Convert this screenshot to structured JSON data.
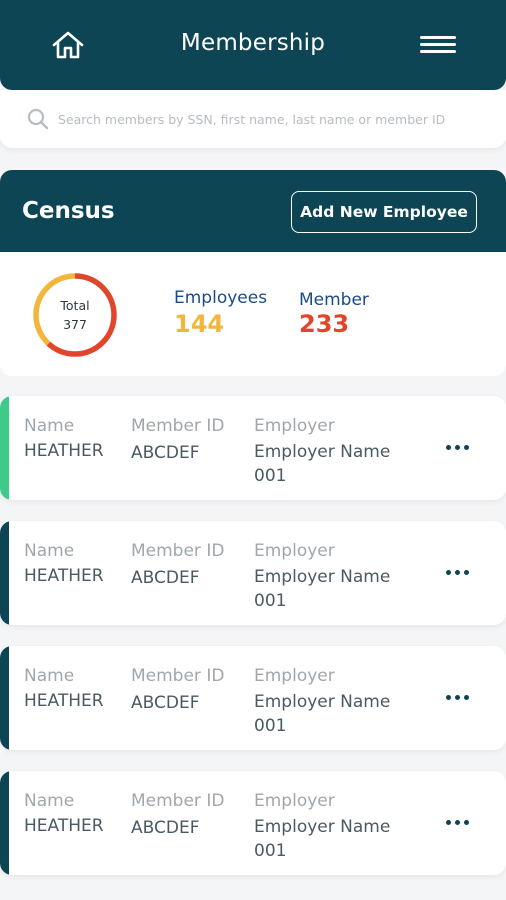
{
  "header": {
    "title": "Membership",
    "home_icon": "home-icon",
    "menu_icon": "hamburger-menu-icon"
  },
  "search": {
    "placeholder": "Search members by SSN, first name, last name or member ID",
    "value": ""
  },
  "census": {
    "title": "Census",
    "add_button_label": "Add New Employee"
  },
  "summary": {
    "total_label": "Total",
    "total_value": "377",
    "employees_label": "Employees",
    "employees_value": "144",
    "member_label": "Member",
    "member_value": "233",
    "colors": {
      "employees": "#f3b63d",
      "member": "#e1452a",
      "accent_dark": "#0d4555",
      "accent_green": "#3ecb8a"
    }
  },
  "labels": {
    "name": "Name",
    "member_id": "Member ID",
    "employer": "Employer"
  },
  "members": [
    {
      "name": "HEATHER",
      "member_id": "ABCDEF",
      "employer": "Employer Name 001",
      "accent": "#3ecb8a"
    },
    {
      "name": "HEATHER",
      "member_id": "ABCDEF",
      "employer": "Employer Name 001",
      "accent": "#0d4555"
    },
    {
      "name": "HEATHER",
      "member_id": "ABCDEF",
      "employer": "Employer Name 001",
      "accent": "#0d4555"
    },
    {
      "name": "HEATHER",
      "member_id": "ABCDEF",
      "employer": "Employer Name 001",
      "accent": "#0d4555"
    }
  ]
}
